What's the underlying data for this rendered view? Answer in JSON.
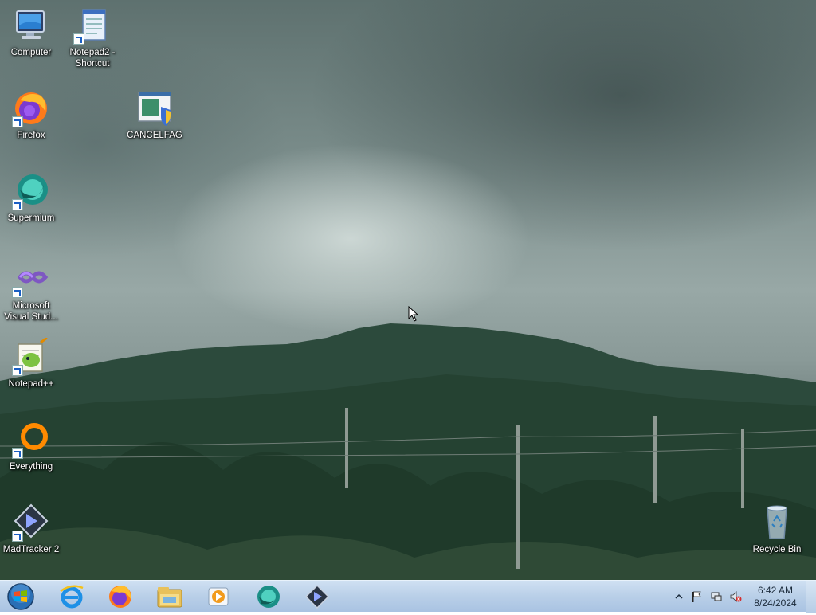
{
  "desktop": {
    "icons": [
      {
        "label": "Computer",
        "icon": "computer-icon"
      },
      {
        "label": "Notepad2 - Shortcut",
        "icon": "notepad2-icon"
      },
      {
        "label": "Firefox",
        "icon": "firefox-icon"
      },
      {
        "label": "CANCELFAG",
        "icon": "installer-shield-icon"
      },
      {
        "label": "Supermium",
        "icon": "supermium-icon"
      },
      {
        "label": "Microsoft Visual Stud...",
        "icon": "visual-studio-icon"
      },
      {
        "label": "Notepad++",
        "icon": "notepadpp-icon"
      },
      {
        "label": "Everything",
        "icon": "everything-icon"
      },
      {
        "label": "MadTracker 2",
        "icon": "madtracker-icon"
      },
      {
        "label": "Recycle Bin",
        "icon": "recycle-bin-icon"
      }
    ]
  },
  "taskbar": {
    "start_icon": "windows-start-orb-icon",
    "pinned": [
      "internet-explorer-icon",
      "firefox-icon",
      "file-explorer-icon",
      "media-player-icon",
      "supermium-icon",
      "madtracker-icon"
    ],
    "tray_icons": [
      "show-hidden-icons-chevron",
      "action-center-flag-icon",
      "network-icon",
      "volume-muted-icon"
    ],
    "clock_time": "6:42 AM",
    "clock_date": "8/24/2024"
  },
  "colors": {
    "taskbar_top": "#cfe0f2",
    "taskbar_bottom": "#a9c3e2",
    "label_text": "#ffffff"
  }
}
